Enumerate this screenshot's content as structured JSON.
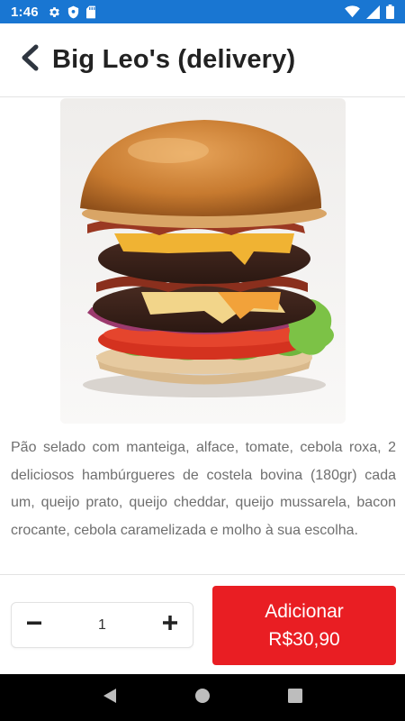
{
  "status_bar": {
    "time": "1:46",
    "left_icons": [
      "gear-icon",
      "shield-icon",
      "sd-card-icon"
    ],
    "right_icons": [
      "wifi-icon",
      "signal-icon",
      "battery-icon"
    ],
    "background_color": "#1976d2"
  },
  "header": {
    "back_icon": "chevron-left-icon",
    "title": "Big Leo's (delivery)"
  },
  "product": {
    "image_subject": "burger",
    "description": "Pão selado com manteiga, alface, tomate, cebola roxa, 2 deliciosos hambúrgueres de costela bovina (180gr) cada um, queijo prato, queijo cheddar, queijo mussarela, bacon crocante, cebola caramelizada e molho à sua escolha."
  },
  "order": {
    "quantity": "1",
    "decrement_icon": "minus-icon",
    "increment_icon": "plus-icon",
    "add_label": "Adicionar",
    "add_price": "R$30,90",
    "accent_color": "#e91e23"
  },
  "nav_bar": {
    "buttons": [
      "back-triangle-icon",
      "home-circle-icon",
      "recents-square-icon"
    ]
  }
}
